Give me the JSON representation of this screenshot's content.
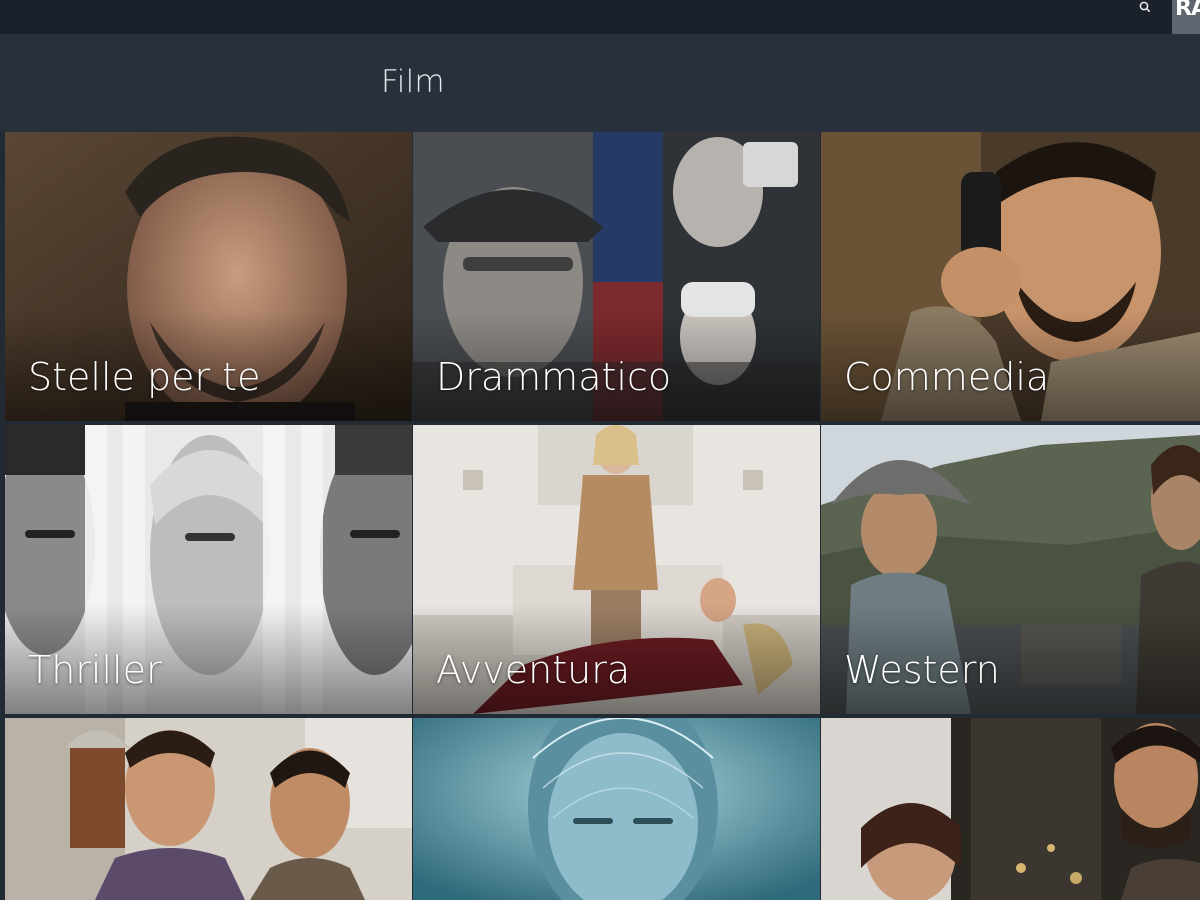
{
  "header": {
    "logo_text": "RAI",
    "search_icon": "search-icon"
  },
  "page": {
    "title": "Film"
  },
  "categories": [
    {
      "label": "Stelle per te"
    },
    {
      "label": "Drammatico"
    },
    {
      "label": "Commedia"
    },
    {
      "label": "Thriller"
    },
    {
      "label": "Avventura"
    },
    {
      "label": "Western"
    },
    {
      "label": ""
    },
    {
      "label": ""
    },
    {
      "label": ""
    }
  ],
  "colors": {
    "topbar": "#1a212b",
    "header": "#27303b",
    "accent_logo_bg": "#5e6670",
    "title_text": "#e6e9ec"
  }
}
